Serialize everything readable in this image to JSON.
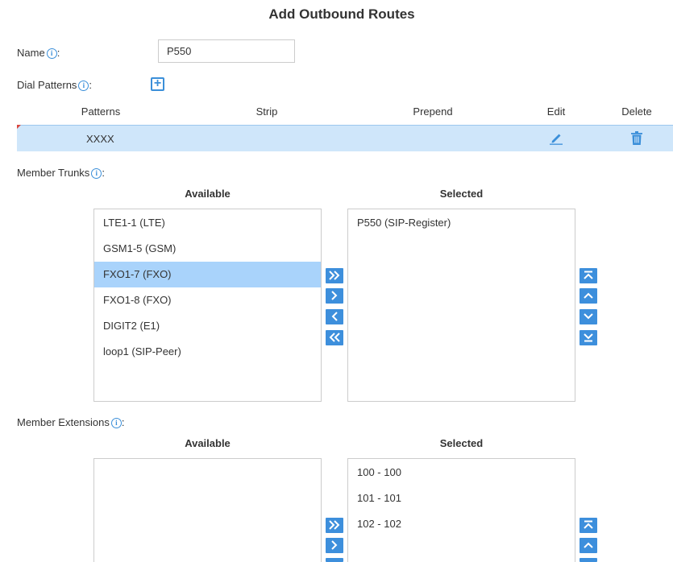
{
  "page": {
    "title": "Add Outbound Routes"
  },
  "name_field": {
    "label": "Name",
    "value": "P550"
  },
  "dial_patterns": {
    "label": "Dial Patterns",
    "columns": [
      "Patterns",
      "Strip",
      "Prepend",
      "Edit",
      "Delete"
    ],
    "rows": [
      {
        "pattern": "XXXX",
        "strip": "",
        "prepend": ""
      }
    ]
  },
  "member_trunks": {
    "label": "Member Trunks",
    "available_header": "Available",
    "selected_header": "Selected",
    "available": [
      "LTE1-1 (LTE)",
      "GSM1-5 (GSM)",
      "FXO1-7 (FXO)",
      "FXO1-8 (FXO)",
      "DIGIT2 (E1)",
      "loop1 (SIP-Peer)"
    ],
    "available_selected_item": "FXO1-7 (FXO)",
    "selected": [
      "P550 (SIP-Register)"
    ]
  },
  "member_extensions": {
    "label": "Member Extensions",
    "available_header": "Available",
    "selected_header": "Selected",
    "available": [],
    "selected": [
      "100 - 100",
      "101 - 101",
      "102 - 102"
    ]
  },
  "colors": {
    "accent": "#3d8fdc",
    "row_highlight": "#cfe6fa",
    "list_selection": "#a9d3fb"
  },
  "icons": [
    "info-icon",
    "plus-icon",
    "pencil-icon",
    "trash-icon",
    "double-right-icon",
    "right-icon",
    "left-icon",
    "double-left-icon",
    "move-top-icon",
    "move-up-icon",
    "move-down-icon",
    "move-bottom-icon"
  ]
}
